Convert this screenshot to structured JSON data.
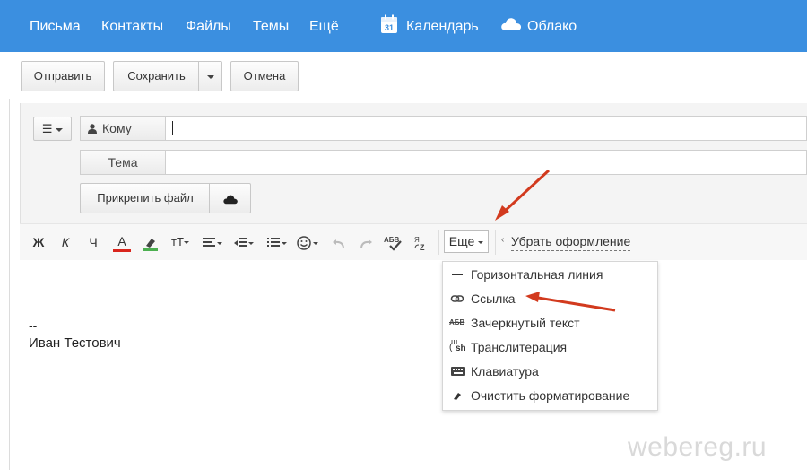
{
  "nav": {
    "items": [
      "Письма",
      "Контакты",
      "Файлы",
      "Темы",
      "Ещё"
    ],
    "calendar_label": "Календарь",
    "calendar_day": "31",
    "cloud_label": "Облако",
    "background_color": "#3b8fe0"
  },
  "actions": {
    "send_label": "Отправить",
    "save_label": "Сохранить",
    "cancel_label": "Отмена"
  },
  "fields": {
    "to_label": "Кому",
    "to_value": "",
    "subject_label": "Тема",
    "subject_value": "",
    "attach_label": "Прикрепить файл"
  },
  "toolbar": {
    "bold": "Ж",
    "italic": "К",
    "underline": "Ч",
    "text_color": "А",
    "more_label": "Еще",
    "remove_format_label": "Убрать оформление"
  },
  "menu": {
    "items": [
      {
        "label": "Горизонтальная линия",
        "icon": "horizontal-line-icon"
      },
      {
        "label": "Ссылка",
        "icon": "link-icon"
      },
      {
        "label": "Зачеркнутый текст",
        "icon": "strikethrough-icon",
        "icon_text": "АБВ"
      },
      {
        "label": "Транслитерация",
        "icon": "transliteration-icon",
        "icon_text": "sh"
      },
      {
        "label": "Клавиатура",
        "icon": "keyboard-icon"
      },
      {
        "label": "Очистить форматирование",
        "icon": "eraser-icon"
      }
    ]
  },
  "signature": {
    "dash": "--",
    "name": "Иван Тестович"
  },
  "watermark": "webereg.ru",
  "colors": {
    "annotation_arrow": "#d23a1e",
    "text_color_underline": "#d9251d",
    "highlight_underline": "#4caf50"
  }
}
